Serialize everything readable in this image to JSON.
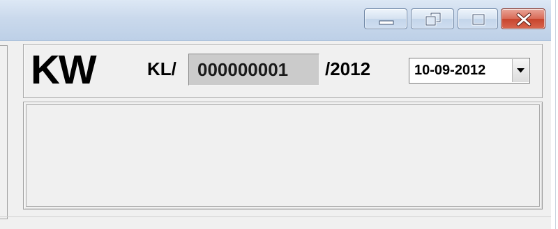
{
  "window": {
    "controls": {
      "minimize_icon": "minimize-icon",
      "restore_icon": "restore-icon",
      "maximize_icon": "maximize-icon",
      "close_icon": "close-icon"
    },
    "colors": {
      "titlebar": "#cad9ec",
      "close_button": "#c7442c",
      "body": "#f0f0f0"
    }
  },
  "header": {
    "title": "KW",
    "number_prefix": "KL/",
    "number_value": "000000001",
    "year_suffix": "/2012",
    "date": {
      "selected": "10-09-2012",
      "arrow_icon": "chevron-down-icon"
    }
  }
}
